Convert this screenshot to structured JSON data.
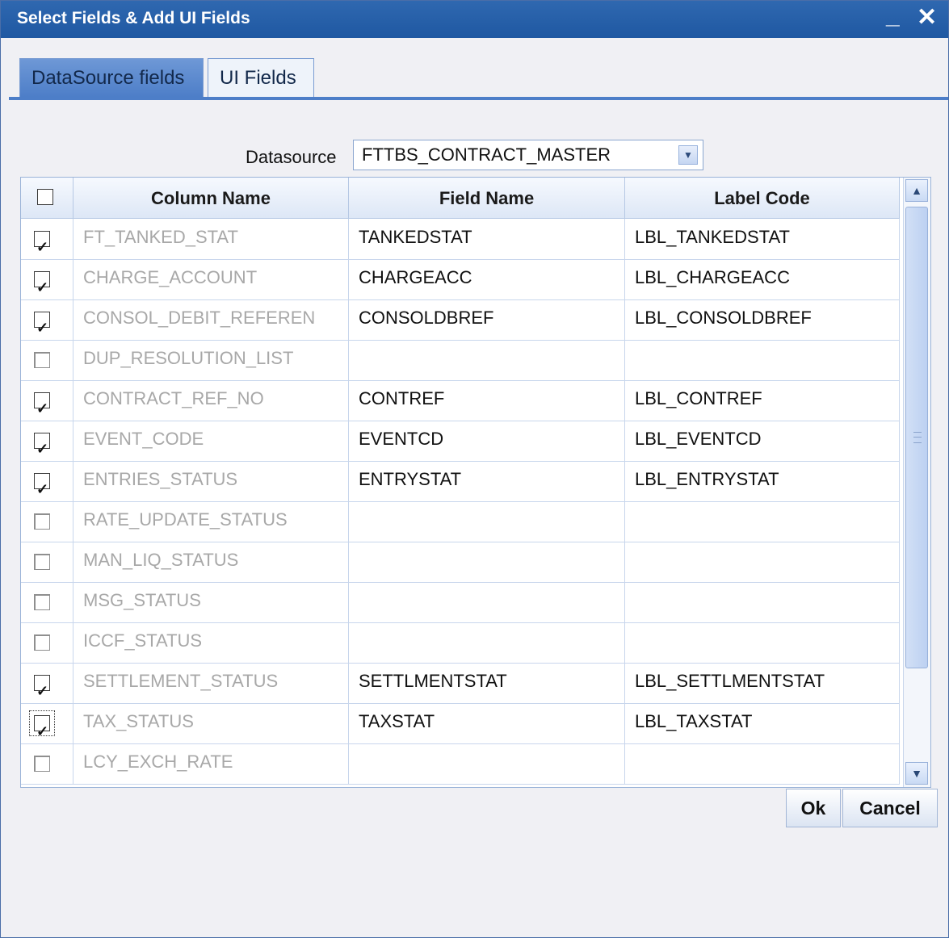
{
  "window": {
    "title": "Select Fields & Add UI Fields",
    "minimize_glyph": "_",
    "close_glyph": "✕"
  },
  "tabs": [
    {
      "label": "DataSource fields",
      "active": true
    },
    {
      "label": "UI Fields",
      "active": false
    }
  ],
  "datasource": {
    "label": "Datasource",
    "value": "FTTBS_CONTRACT_MASTER"
  },
  "table": {
    "headers": {
      "select_all": "",
      "column_name": "Column Name",
      "field_name": "Field Name",
      "label_code": "Label Code"
    },
    "rows": [
      {
        "checked": true,
        "column_name": "FT_TANKED_STAT",
        "field_name": "TANKEDSTAT",
        "label_code": "LBL_TANKEDSTAT"
      },
      {
        "checked": true,
        "column_name": "CHARGE_ACCOUNT",
        "field_name": "CHARGEACC",
        "label_code": "LBL_CHARGEACC"
      },
      {
        "checked": true,
        "column_name": "CONSOL_DEBIT_REFEREN",
        "field_name": "CONSOLDBREF",
        "label_code": "LBL_CONSOLDBREF"
      },
      {
        "checked": false,
        "column_name": "DUP_RESOLUTION_LIST",
        "field_name": "",
        "label_code": ""
      },
      {
        "checked": true,
        "column_name": "CONTRACT_REF_NO",
        "field_name": "CONTREF",
        "label_code": "LBL_CONTREF"
      },
      {
        "checked": true,
        "column_name": "EVENT_CODE",
        "field_name": "EVENTCD",
        "label_code": "LBL_EVENTCD"
      },
      {
        "checked": true,
        "column_name": "ENTRIES_STATUS",
        "field_name": "ENTRYSTAT",
        "label_code": "LBL_ENTRYSTAT"
      },
      {
        "checked": false,
        "column_name": "RATE_UPDATE_STATUS",
        "field_name": "",
        "label_code": ""
      },
      {
        "checked": false,
        "column_name": "MAN_LIQ_STATUS",
        "field_name": "",
        "label_code": ""
      },
      {
        "checked": false,
        "column_name": "MSG_STATUS",
        "field_name": "",
        "label_code": ""
      },
      {
        "checked": false,
        "column_name": "ICCF_STATUS",
        "field_name": "",
        "label_code": ""
      },
      {
        "checked": true,
        "column_name": "SETTLEMENT_STATUS",
        "field_name": "SETTLMENTSTAT",
        "label_code": "LBL_SETTLMENTSTAT"
      },
      {
        "checked": true,
        "column_name": "TAX_STATUS",
        "field_name": "TAXSTAT",
        "label_code": "LBL_TAXSTAT",
        "focused": true
      },
      {
        "checked": false,
        "column_name": "LCY_EXCH_RATE",
        "field_name": "",
        "label_code": ""
      }
    ]
  },
  "buttons": {
    "ok": "Ok",
    "cancel": "Cancel"
  },
  "icons": {
    "dropdown": "chevron-down-icon",
    "scroll_up": "chevron-up-icon",
    "scroll_down": "chevron-down-icon"
  }
}
